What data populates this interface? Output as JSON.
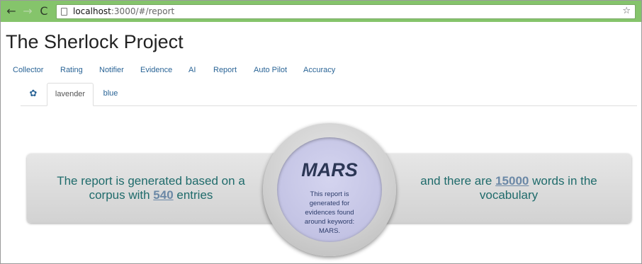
{
  "browser": {
    "back_icon": "arrow-left-icon",
    "forward_icon": "arrow-right-icon",
    "reload_icon": "reload-icon",
    "url_host": "localhost",
    "url_rest": ":3000/#/report",
    "bookmark_icon": "star-icon"
  },
  "app": {
    "title": "The Sherlock Project"
  },
  "main_nav": [
    "Collector",
    "Rating",
    "Notifier",
    "Evidence",
    "AI",
    "Report",
    "Auto Pilot",
    "Accuracy"
  ],
  "tabs": {
    "settings_icon": "gear-icon",
    "items": [
      "lavender",
      "blue"
    ],
    "active": "lavender"
  },
  "report": {
    "left_prefix": "The report is generated based on a corpus with ",
    "entries": "540",
    "left_suffix": " entries",
    "right_prefix": "and there are ",
    "words": "15000",
    "right_suffix": " words in the vocabulary",
    "keyword": "MARS",
    "description": "This report is generated for evidences found around keyword: MARS."
  },
  "colors": {
    "browser_bar": "#85c46b",
    "link": "#2a6496",
    "band_text": "#1f6b6b",
    "circle_inner": "#c3c3e4"
  }
}
